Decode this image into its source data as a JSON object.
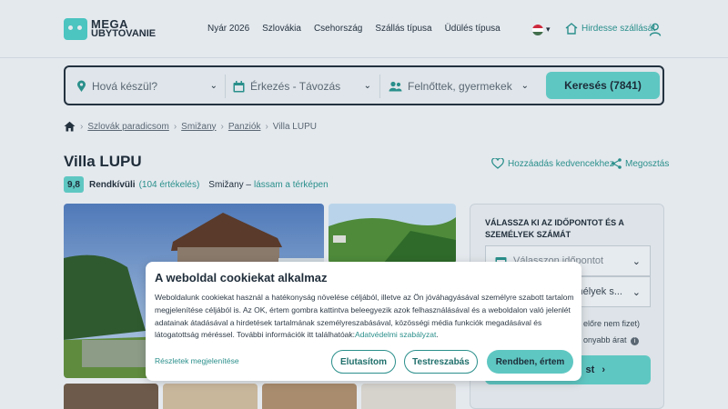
{
  "header": {
    "logo_line1": "MEGA",
    "logo_line2": "UBYTOVANIE",
    "nav": [
      "Nyár 2026",
      "Szlovákia",
      "Csehország",
      "Szállás típusa",
      "Üdülés típusa"
    ],
    "host_label": "Hirdesse szállását"
  },
  "search": {
    "destination_placeholder": "Hová készül?",
    "dates_placeholder": "Érkezés - Távozás",
    "guests_placeholder": "Felnőttek, gyermekek",
    "button_label": "Keresés (7841)"
  },
  "breadcrumb": [
    "Szlovák paradicsom",
    "Smižany",
    "Panziók",
    "Villa LUPU"
  ],
  "property": {
    "title": "Villa LUPU",
    "favorite_label": "Hozzáadás kedvencekhez",
    "share_label": "Megosztás",
    "score": "9,8",
    "rating_word": "Rendkívüli",
    "review_count": "(104 értékelés)",
    "location": "Smižany –",
    "map_link": "lássam a térképen"
  },
  "sidebar": {
    "title": "VÁLASSZA KI AZ IDŐPONTOT ÉS A SZEMÉLYEK SZÁMÁT",
    "date_placeholder": "Válasszon időpontot",
    "guests_placeholder": "...mélyek s...",
    "note1": "előre nem fizet)",
    "note2": "onyabb árat",
    "button_tail": "st"
  },
  "cookie": {
    "title": "A weboldal cookiekat alkalmaz",
    "text": "Weboldalunk cookiekat használ a hatékonyság növelése céljából, illetve az Ön jóváhagyásával személyre szabott tartalom megjelenítése céljából is. Az OK, értem gombra kattintva beleegyezik azok felhasználásával és a weboldalon való jelenlét adatainak átadásával a hirdetések tartalmának személyreszabásával, közösségi média funkciók megadásával és látogatottság méréssel. További információk itt találhatóak:",
    "policy_link": "Adatvédelmi szabályzat",
    "details_label": "Részletek megjelenítése",
    "reject_label": "Elutasítom",
    "customize_label": "Testreszabás",
    "accept_label": "Rendben, értem"
  },
  "colors": {
    "accent": "#5fc7c2",
    "link": "#2a8f8b",
    "dark": "#24323f"
  }
}
